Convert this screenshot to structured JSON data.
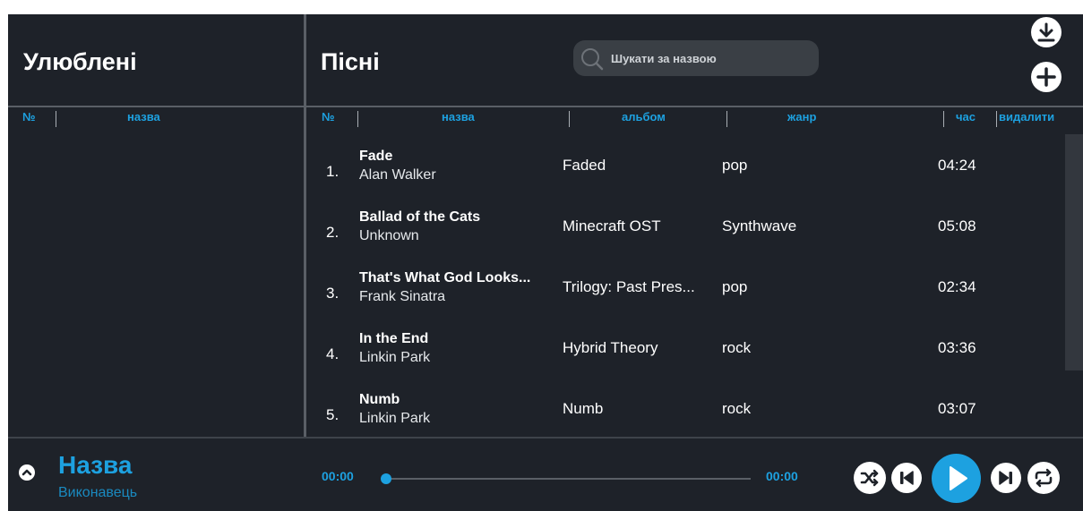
{
  "favorites": {
    "title": "Улюблені",
    "columns": {
      "num": "№",
      "name": "назва"
    }
  },
  "songs": {
    "title": "Пісні",
    "search_placeholder": "Шукати за назвою",
    "columns": {
      "num": "№",
      "name": "назва",
      "album": "альбом",
      "genre": "жанр",
      "time": "час",
      "delete": "видалити"
    },
    "rows": [
      {
        "num": "1.",
        "title": "Fade",
        "artist": "Alan Walker",
        "album": "Faded",
        "genre": "pop",
        "duration": "04:24"
      },
      {
        "num": "2.",
        "title": "Ballad of the Cats",
        "artist": "Unknown",
        "album": "Minecraft OST",
        "genre": "Synthwave",
        "duration": "05:08"
      },
      {
        "num": "3.",
        "title": "That's What God Looks...",
        "artist": "Frank Sinatra",
        "album": "Trilogy: Past Pres...",
        "genre": "pop",
        "duration": "02:34"
      },
      {
        "num": "4.",
        "title": "In the End",
        "artist": "Linkin Park",
        "album": "Hybrid Theory",
        "genre": "rock",
        "duration": "03:36"
      },
      {
        "num": "5.",
        "title": "Numb",
        "artist": "Linkin Park",
        "album": "Numb",
        "genre": "rock",
        "duration": "03:07"
      }
    ]
  },
  "player": {
    "title": "Назва",
    "artist": "Виконавець",
    "current_time": "00:00",
    "total_time": "00:00",
    "progress": 0
  },
  "icons": {
    "download": "download-icon",
    "add": "plus-icon",
    "search": "search-icon",
    "collapse": "chevron-up-icon",
    "shuffle": "shuffle-icon",
    "previous": "skip-previous-icon",
    "play": "play-icon",
    "next": "skip-next-icon",
    "repeat": "repeat-icon"
  },
  "colors": {
    "background": "#1e2229",
    "accent": "#1da1e0",
    "divider": "#5a5f66",
    "text": "#ffffff"
  }
}
